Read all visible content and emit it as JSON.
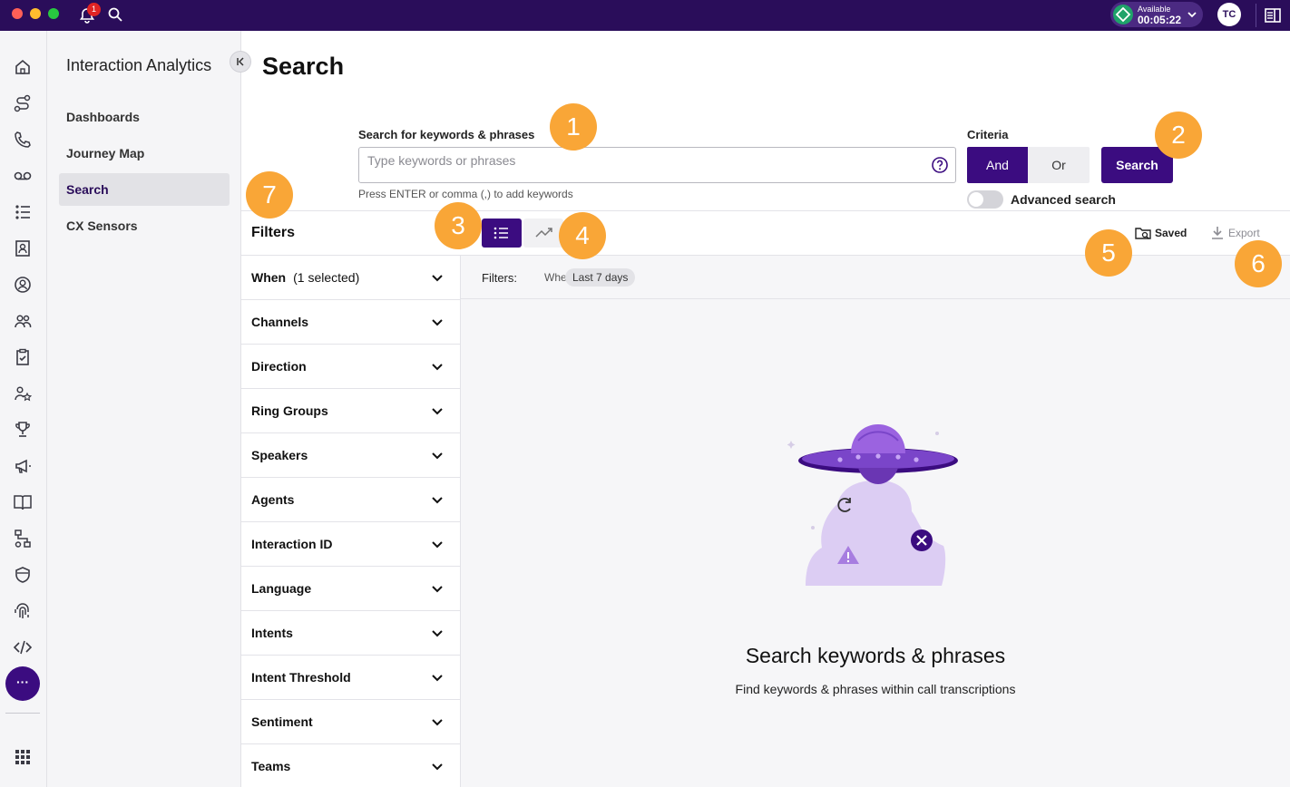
{
  "topbar": {
    "notification_count": "1",
    "status_label": "Available",
    "status_timer": "00:05:22",
    "avatar_initials": "TC"
  },
  "rail": {
    "icons": [
      "home-icon",
      "route-icon",
      "phone-icon",
      "voicemail-icon",
      "list-icon",
      "contact-card-icon",
      "user-circle-icon",
      "team-icon",
      "clipboard-check-icon",
      "user-star-icon",
      "trophy-icon",
      "megaphone-icon",
      "book-icon",
      "workflow-icon",
      "shield-icon",
      "fingerprint-icon",
      "code-icon"
    ],
    "more_label": "···"
  },
  "subnav": {
    "title": "Interaction Analytics",
    "items": [
      {
        "label": "Dashboards",
        "active": false
      },
      {
        "label": "Journey Map",
        "active": false
      },
      {
        "label": "Search",
        "active": true
      },
      {
        "label": "CX Sensors",
        "active": false
      }
    ]
  },
  "main": {
    "title": "Search",
    "search": {
      "label": "Search for keywords & phrases",
      "placeholder": "Type keywords or phrases",
      "hint": "Press ENTER or comma (,) to add keywords"
    },
    "criteria": {
      "label": "Criteria",
      "and_label": "And",
      "or_label": "Or",
      "selected": "And"
    },
    "search_button": "Search",
    "advanced_search_label": "Advanced search",
    "advanced_search_enabled": false
  },
  "toolbar": {
    "filters_heading": "Filters",
    "saved_label": "Saved",
    "export_label": "Export",
    "active_view": "list"
  },
  "filters": [
    {
      "label": "When",
      "count": "(1 selected)"
    },
    {
      "label": "Channels",
      "count": ""
    },
    {
      "label": "Direction",
      "count": ""
    },
    {
      "label": "Ring Groups",
      "count": ""
    },
    {
      "label": "Speakers",
      "count": ""
    },
    {
      "label": "Agents",
      "count": ""
    },
    {
      "label": "Interaction ID",
      "count": ""
    },
    {
      "label": "Language",
      "count": ""
    },
    {
      "label": "Intents",
      "count": ""
    },
    {
      "label": "Intent Threshold",
      "count": ""
    },
    {
      "label": "Sentiment",
      "count": ""
    },
    {
      "label": "Teams",
      "count": ""
    }
  ],
  "applied_filters": {
    "label": "Filters:",
    "when_label": "When",
    "when_value": "Last 7 days"
  },
  "empty_state": {
    "title": "Search keywords & phrases",
    "subtitle": "Find keywords & phrases within call transcriptions"
  },
  "markers": [
    "1",
    "2",
    "3",
    "4",
    "5",
    "6",
    "7"
  ],
  "colors": {
    "topbar": "#2a0d5a",
    "primary": "#3b0c80",
    "marker": "#f9a637",
    "status_green": "#1fa36a",
    "badge_red": "#e02424"
  }
}
